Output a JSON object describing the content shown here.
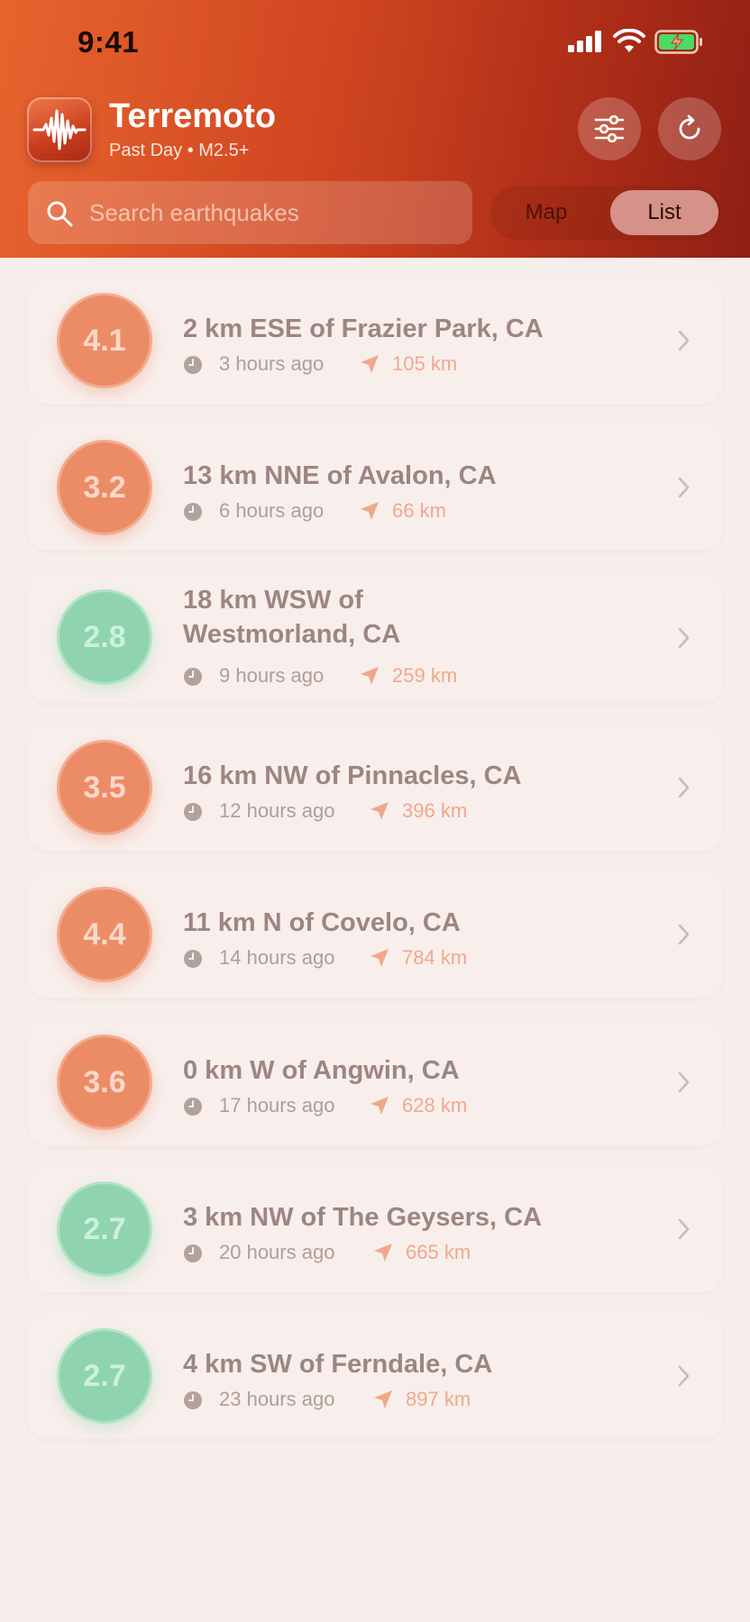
{
  "status_bar": {
    "time": "9:41",
    "icons": [
      "cellular-signal-icon",
      "wifi-icon",
      "battery-charging-icon"
    ]
  },
  "header": {
    "app_name": "Terremoto",
    "subtitle": "Past Day • M2.5+",
    "icons": [
      "seismic-wave-icon",
      "sliders-icon",
      "refresh-icon"
    ]
  },
  "search": {
    "placeholder": "Search earthquakes",
    "value": "",
    "icon": "search-icon"
  },
  "view_toggle": {
    "options": [
      "Map",
      "List"
    ],
    "selected": "List"
  },
  "colors": {
    "header_start": "#e8642e",
    "header_end": "#8f2014",
    "mag_orange": "#ec8c67",
    "mag_green": "#8fd4ae",
    "distance_text": "#f0a88b",
    "background": "#f6eeea"
  },
  "quakes": [
    {
      "magnitude": "4.1",
      "level": "orange",
      "place": "2 km ESE of Frazier Park, CA",
      "time_ago": "3 hours ago",
      "distance": "105 km"
    },
    {
      "magnitude": "3.2",
      "level": "orange",
      "place": "13 km NNE of Avalon, CA",
      "time_ago": "6 hours ago",
      "distance": "66 km"
    },
    {
      "magnitude": "2.8",
      "level": "green",
      "place": "18 km WSW of Westmorland, CA",
      "time_ago": "9 hours ago",
      "distance": "259 km"
    },
    {
      "magnitude": "3.5",
      "level": "orange",
      "place": "16 km NW of Pinnacles, CA",
      "time_ago": "12 hours ago",
      "distance": "396 km"
    },
    {
      "magnitude": "4.4",
      "level": "orange",
      "place": "11 km N of Covelo, CA",
      "time_ago": "14 hours ago",
      "distance": "784 km"
    },
    {
      "magnitude": "3.6",
      "level": "orange",
      "place": "0 km W of Angwin, CA",
      "time_ago": "17 hours ago",
      "distance": "628 km"
    },
    {
      "magnitude": "2.7",
      "level": "green",
      "place": "3 km NW of The Geysers, CA",
      "time_ago": "20 hours ago",
      "distance": "665 km"
    },
    {
      "magnitude": "2.7",
      "level": "green",
      "place": "4 km SW of Ferndale, CA",
      "time_ago": "23 hours ago",
      "distance": "897 km"
    }
  ]
}
